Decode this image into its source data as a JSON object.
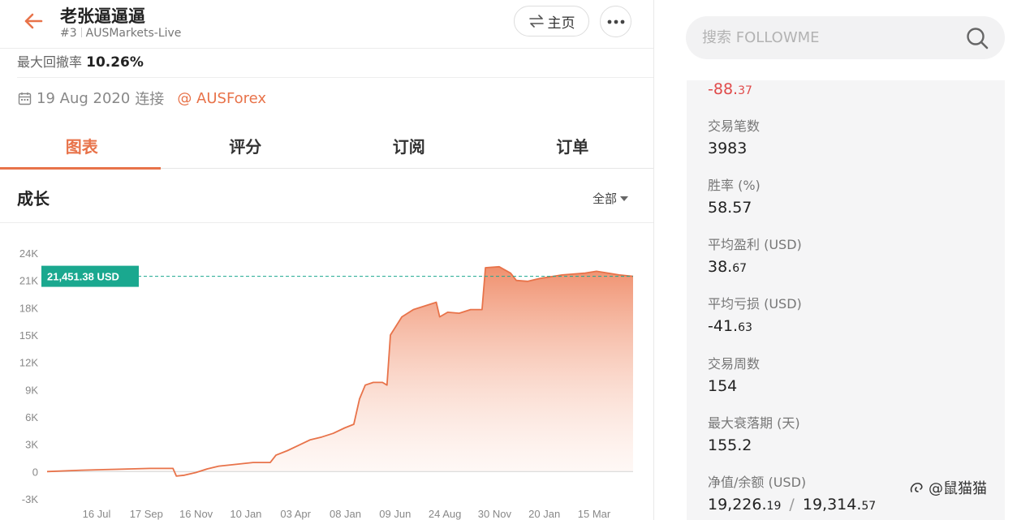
{
  "header": {
    "title": "老张逼逼逼",
    "rank": "#3",
    "broker": "AUSMarkets-Live",
    "home_label": "主页"
  },
  "summary": {
    "max_drawdown_label": "最大回撤率",
    "max_drawdown_value": "10.26%",
    "date": "19 Aug 2020",
    "connect_label": "连接",
    "connect_link": "@ AUSForex"
  },
  "tabs": [
    {
      "label": "图表",
      "active": true
    },
    {
      "label": "评分",
      "active": false
    },
    {
      "label": "订阅",
      "active": false
    },
    {
      "label": "订单",
      "active": false
    }
  ],
  "section": {
    "title": "成长",
    "range_label": "全部"
  },
  "search": {
    "placeholder": "搜索 FOLLOWME"
  },
  "stats": {
    "top_value_int": "-88.",
    "top_value_dec": "37",
    "trades_label": "交易笔数",
    "trades_value": "3983",
    "winrate_label": "胜率 (%)",
    "winrate_value": "58.57",
    "avg_profit_label": "平均盈利 (USD)",
    "avg_profit_int": "38.",
    "avg_profit_dec": "67",
    "avg_loss_label": "平均亏损 (USD)",
    "avg_loss_int": "-41.",
    "avg_loss_dec": "63",
    "weeks_label": "交易周数",
    "weeks_value": "154",
    "max_decline_label": "最大衰落期 (天)",
    "max_decline_value": "155.2",
    "equity_label": "净值/余额 (USD)",
    "equity_int": "19,226.",
    "equity_dec": "19",
    "balance_int": "19,314.",
    "balance_dec": "57"
  },
  "watermark": {
    "text": "@鼠猫猫"
  },
  "colors": {
    "accent": "#e8734a",
    "teal": "#1aa88f",
    "red": "#e04a4a"
  },
  "chart_data": {
    "type": "area",
    "title": "",
    "xlabel": "",
    "ylabel": "",
    "ylim": [
      -3000,
      24000
    ],
    "yticks": [
      24000,
      21000,
      18000,
      15000,
      12000,
      9000,
      6000,
      3000,
      0,
      -3000
    ],
    "ytick_labels": [
      "24K",
      "21K",
      "18K",
      "15K",
      "12K",
      "9K",
      "6K",
      "3K",
      "0",
      "-3K"
    ],
    "xtick_labels": [
      "16 Jul",
      "17 Sep",
      "16 Nov",
      "10 Jan",
      "03 Apr",
      "08 Jan",
      "09 Jun",
      "24 Aug",
      "30 Nov",
      "20 Jan",
      "15 Mar"
    ],
    "current_label": "21,451.38 USD",
    "current_value": 21451.38,
    "grid": false,
    "series": [
      {
        "values": [
          [
            0,
            0
          ],
          [
            3,
            150
          ],
          [
            6,
            250
          ],
          [
            9,
            350
          ],
          [
            11,
            350
          ],
          [
            11.3,
            -500
          ],
          [
            12,
            -400
          ],
          [
            13,
            -100
          ],
          [
            14,
            300
          ],
          [
            15,
            600
          ],
          [
            16.5,
            800
          ],
          [
            18,
            1000
          ],
          [
            19.5,
            1000
          ],
          [
            20,
            1800
          ],
          [
            21,
            2300
          ],
          [
            22,
            2900
          ],
          [
            23,
            3500
          ],
          [
            24,
            3800
          ],
          [
            25,
            4200
          ],
          [
            26,
            4800
          ],
          [
            26.8,
            5200
          ],
          [
            27.3,
            8000
          ],
          [
            27.8,
            9500
          ],
          [
            28.5,
            9800
          ],
          [
            29.3,
            9800
          ],
          [
            29.7,
            9500
          ],
          [
            30,
            15000
          ],
          [
            31,
            17000
          ],
          [
            32,
            17800
          ],
          [
            33,
            18200
          ],
          [
            34,
            18600
          ],
          [
            34.3,
            17000
          ],
          [
            35,
            17500
          ],
          [
            36,
            17400
          ],
          [
            37,
            17800
          ],
          [
            38,
            17800
          ],
          [
            38.3,
            22400
          ],
          [
            39.5,
            22500
          ],
          [
            40.5,
            21800
          ],
          [
            41,
            21000
          ],
          [
            42,
            20900
          ],
          [
            43,
            21200
          ],
          [
            45,
            21600
          ],
          [
            47,
            21800
          ],
          [
            48,
            22000
          ],
          [
            49,
            21800
          ],
          [
            50,
            21600
          ],
          [
            51.2,
            21451.38
          ]
        ]
      }
    ]
  }
}
